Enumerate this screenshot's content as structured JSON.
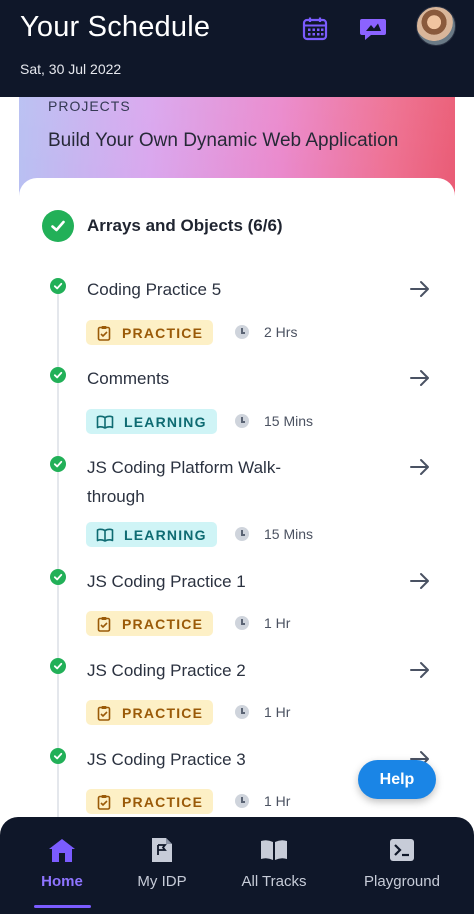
{
  "header": {
    "title": "Your Schedule",
    "date": "Sat, 30 Jul 2022",
    "calendar_icon": "calendar-icon",
    "chat_icon": "chat-icon",
    "avatar": "user-avatar"
  },
  "project": {
    "label": "PROJECTS",
    "title": "Build Your Own Dynamic Web Application"
  },
  "section": {
    "title": "Arrays and Objects (6/6)"
  },
  "items": [
    {
      "name": "Coding Practice 5",
      "tag": "PRACTICE",
      "duration": "2 Hrs"
    },
    {
      "name": "Comments",
      "tag": "LEARNING",
      "duration": "15 Mins"
    },
    {
      "name": "JS Coding Platform Walk-through",
      "tag": "LEARNING",
      "duration": "15 Mins"
    },
    {
      "name": "JS Coding Practice 1",
      "tag": "PRACTICE",
      "duration": "1 Hr"
    },
    {
      "name": "JS Coding Practice 2",
      "tag": "PRACTICE",
      "duration": "1 Hr"
    },
    {
      "name": "JS Coding Practice 3",
      "tag": "PRACTICE",
      "duration": "1 Hr"
    }
  ],
  "help": {
    "label": "Help"
  },
  "nav": {
    "items": [
      {
        "label": "Home",
        "icon": "home-icon",
        "active": true
      },
      {
        "label": "My IDP",
        "icon": "idp-document-icon",
        "active": false
      },
      {
        "label": "All Tracks",
        "icon": "book-icon",
        "active": false
      },
      {
        "label": "Playground",
        "icon": "terminal-icon",
        "active": false
      }
    ]
  },
  "colors": {
    "header_bg": "#0f1729",
    "accent": "#7b5cff",
    "success": "#22b058",
    "help_bg": "#1a85e6"
  }
}
